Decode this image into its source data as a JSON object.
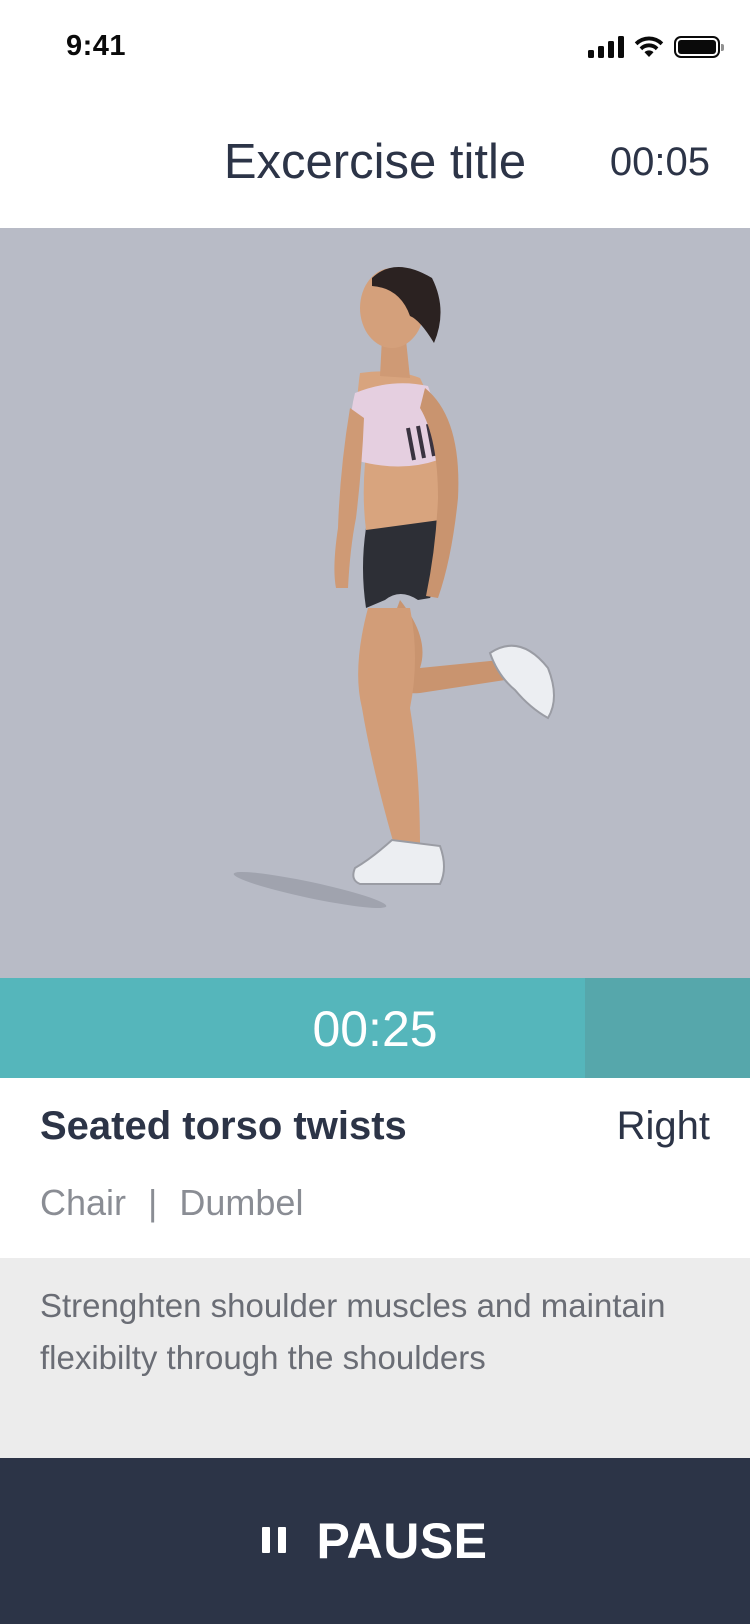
{
  "status_bar": {
    "time": "9:41",
    "icons": [
      "cellular-signal-icon",
      "wifi-icon",
      "battery-icon"
    ]
  },
  "header": {
    "title": "Excercise title",
    "elapsed": "00:05"
  },
  "hero": {
    "image": "woman-standing-leg-curl-figure",
    "background_color": "#b8bbc6"
  },
  "timer": {
    "remaining": "00:25",
    "progress_fraction": 0.78,
    "color": "#55b6bb"
  },
  "exercise": {
    "name": "Seated torso twists",
    "side": "Right",
    "equipment": [
      "Chair",
      "|",
      "Dumbel"
    ]
  },
  "description": {
    "text": "Strenghten shoulder muscles and maintain flexibilty through the shoulders"
  },
  "pause_button": {
    "label": "PAUSE",
    "icon": "pause-icon",
    "color": "#2c3447"
  }
}
